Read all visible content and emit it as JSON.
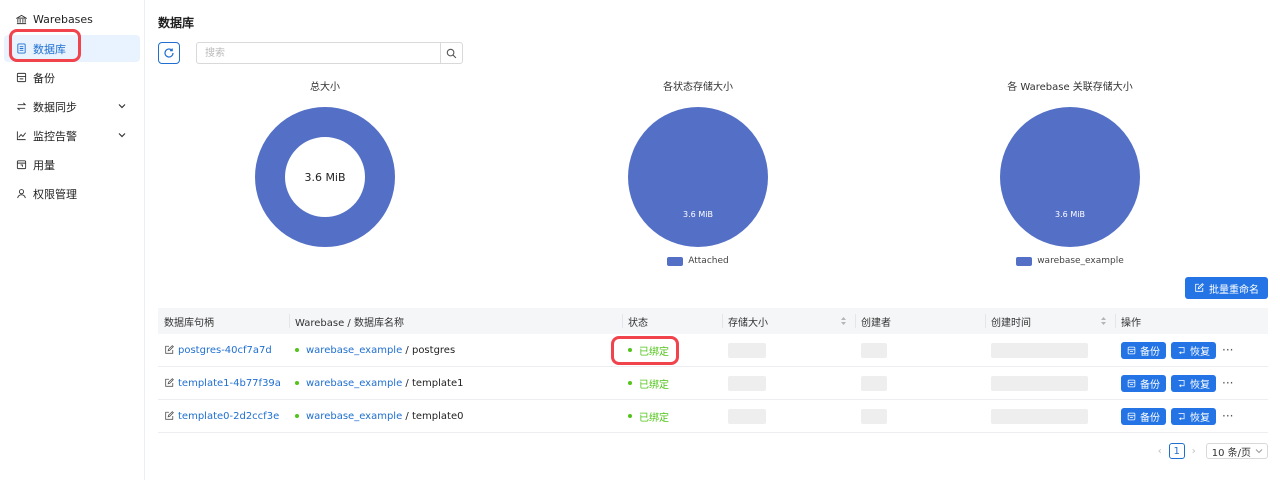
{
  "sidebar": {
    "items": [
      {
        "label": "Warebases",
        "icon": "bank-icon"
      },
      {
        "label": "数据库",
        "icon": "database-icon",
        "active": true
      },
      {
        "label": "备份",
        "icon": "backup-icon"
      },
      {
        "label": "数据同步",
        "icon": "sync-icon",
        "expandable": true
      },
      {
        "label": "监控告警",
        "icon": "chart-line-icon",
        "expandable": true
      },
      {
        "label": "用量",
        "icon": "calendar-icon"
      },
      {
        "label": "权限管理",
        "icon": "user-icon"
      }
    ]
  },
  "page": {
    "title": "数据库",
    "search_placeholder": "搜索"
  },
  "charts": [
    {
      "title": "总大小",
      "center_label": "3.6 MiB",
      "legend": ""
    },
    {
      "title": "各状态存储大小",
      "slice_label": "3.6 MiB",
      "legend": "Attached"
    },
    {
      "title": "各 Warebase 关联存储大小",
      "slice_label": "3.6 MiB",
      "legend": "warebase_example"
    }
  ],
  "chart_data": [
    {
      "type": "pie",
      "title": "总大小",
      "categories": [
        "总大小"
      ],
      "values": [
        3.6
      ],
      "unit": "MiB",
      "donut": true
    },
    {
      "type": "pie",
      "title": "各状态存储大小",
      "categories": [
        "Attached"
      ],
      "values": [
        3.6
      ],
      "unit": "MiB"
    },
    {
      "type": "pie",
      "title": "各 Warebase 关联存储大小",
      "categories": [
        "warebase_example"
      ],
      "values": [
        3.6
      ],
      "unit": "MiB"
    }
  ],
  "colors": {
    "accent": "#2474e5",
    "chart": "#5470c6",
    "status_ok": "#52c41a",
    "highlight": "#f0434c"
  },
  "batch_rename_label": "批量重命名",
  "table": {
    "columns": [
      "数据库句柄",
      "Warebase / 数据库名称",
      "状态",
      "存储大小",
      "创建者",
      "创建时间",
      "操作"
    ],
    "rows": [
      {
        "handle": "postgres-40cf7a7d",
        "warebase": "warebase_example",
        "dbname": "/ postgres",
        "status": "已绑定"
      },
      {
        "handle": "template1-4b77f39a",
        "warebase": "warebase_example",
        "dbname": "/ template1",
        "status": "已绑定"
      },
      {
        "handle": "template0-2d2ccf3e",
        "warebase": "warebase_example",
        "dbname": "/ template0",
        "status": "已绑定"
      }
    ],
    "actions": {
      "backup": "备份",
      "restore": "恢复",
      "more": "···"
    }
  },
  "pagination": {
    "current": "1",
    "page_size": "10 条/页"
  }
}
